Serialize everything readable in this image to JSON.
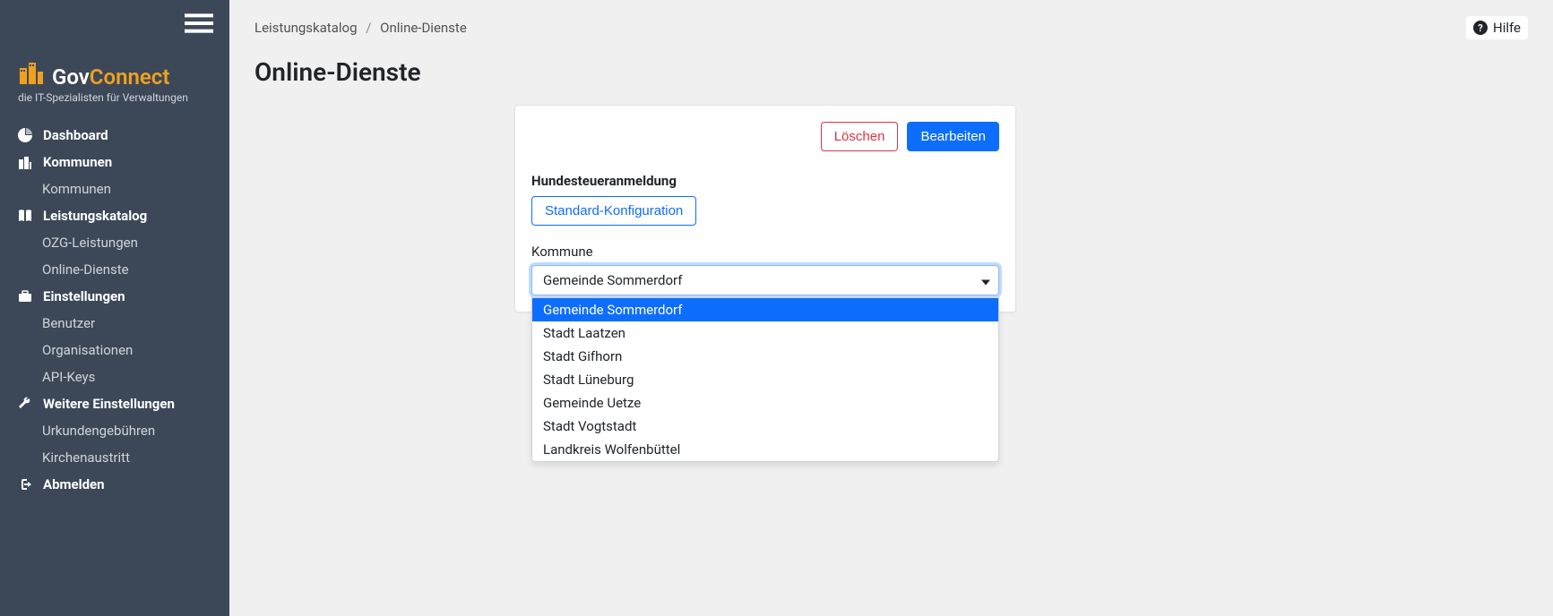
{
  "logo": {
    "brand_part1": "Gov",
    "brand_part2": "Connect",
    "tagline": "die IT-Spezialisten für Verwaltungen"
  },
  "nav": {
    "dashboard": "Dashboard",
    "kommunen_header": "Kommunen",
    "kommunen_sub": "Kommunen",
    "leistungskatalog_header": "Leistungskatalog",
    "ozg_leistungen": "OZG-Leistungen",
    "online_dienste": "Online-Dienste",
    "einstellungen_header": "Einstellungen",
    "benutzer": "Benutzer",
    "organisationen": "Organisationen",
    "api_keys": "API-Keys",
    "weitere_header": "Weitere Einstellungen",
    "urkundengebuehren": "Urkundengebühren",
    "kirchenaustritt": "Kirchenaustritt",
    "abmelden": "Abmelden"
  },
  "breadcrumb": {
    "parent": "Leistungskatalog",
    "current": "Online-Dienste"
  },
  "help_label": "Hilfe",
  "page_title": "Online-Dienste",
  "card": {
    "delete_button": "Löschen",
    "edit_button": "Bearbeiten",
    "service_title": "Hundesteueranmeldung",
    "config_button": "Standard-Konfiguration",
    "kommune_label": "Kommune",
    "selected_value": "Gemeinde Sommerdorf",
    "options": [
      "Gemeinde Sommerdorf",
      "Stadt Laatzen",
      "Stadt Gifhorn",
      "Stadt Lüneburg",
      "Gemeinde Uetze",
      "Stadt Vogtstadt",
      "Landkreis Wolfenbüttel"
    ]
  }
}
